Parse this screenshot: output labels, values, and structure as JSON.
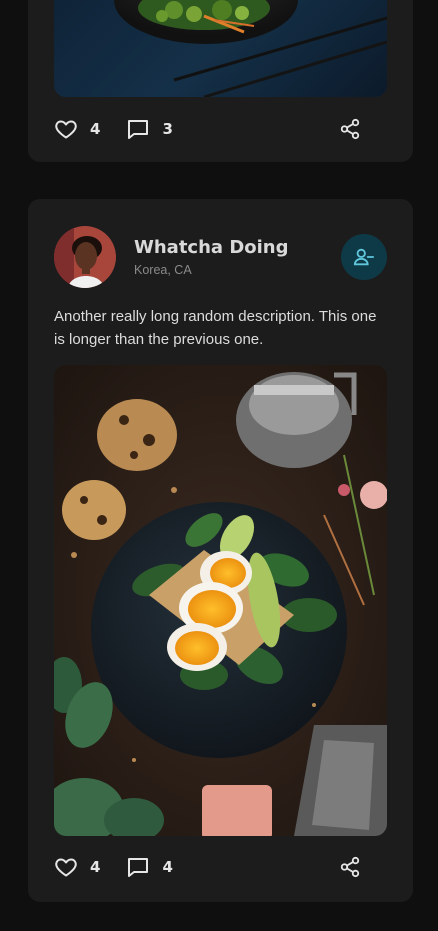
{
  "posts": [
    {
      "likes": "4",
      "comments": "3"
    },
    {
      "author": {
        "name": "Whatcha Doing",
        "location": "Korea, CA"
      },
      "description": "Another really long random description. This one is longer than the previous one.",
      "likes": "4",
      "comments": "4"
    }
  ],
  "icons": {
    "like": "heart-icon",
    "comment": "comment-icon",
    "share": "share-icon",
    "follow": "user-minus-icon"
  },
  "colors": {
    "background": "#0f0f0f",
    "card": "#1c1c1c",
    "follow_button": "#0e3a47",
    "follow_icon": "#5fc6dc"
  }
}
